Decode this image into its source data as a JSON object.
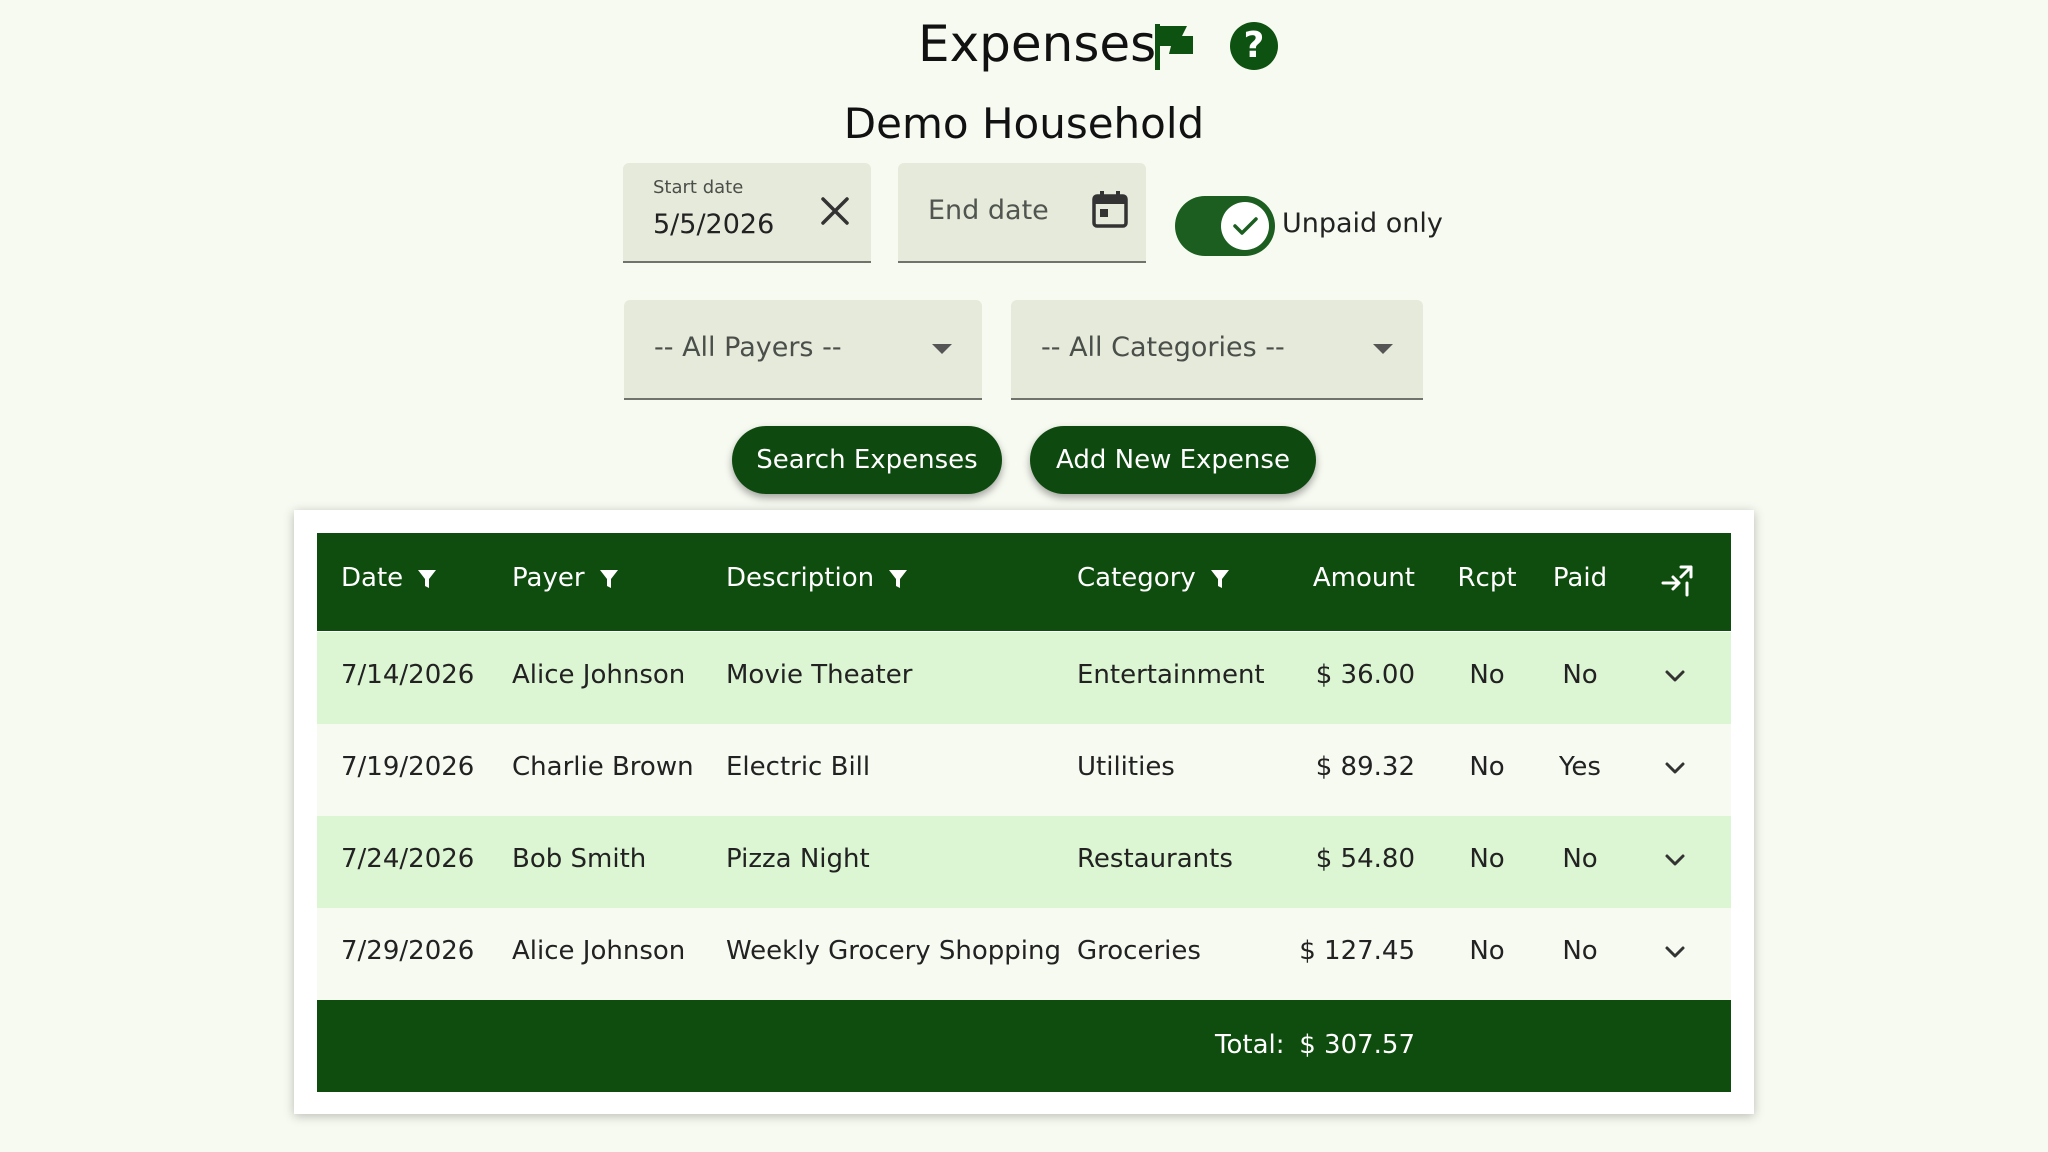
{
  "header": {
    "title": "Expenses",
    "household": "Demo Household",
    "accent": "#0e5212"
  },
  "filters": {
    "start_date_label": "Start date",
    "start_date_value": "5/5/2026",
    "end_date_placeholder": "End date",
    "unpaid_only_label": "Unpaid only",
    "unpaid_only_checked": true,
    "payers_selected": "-- All Payers --",
    "categories_selected": "-- All Categories --"
  },
  "actions": {
    "search_label": "Search Expenses",
    "add_label": "Add New Expense"
  },
  "table": {
    "columns": [
      "Date",
      "Payer",
      "Description",
      "Category",
      "Amount",
      "Rcpt",
      "Paid"
    ],
    "rows": [
      {
        "date": "7/14/2026",
        "payer": "Alice Johnson",
        "description": "Movie Theater",
        "category": "Entertainment",
        "amount": "$ 36.00",
        "rcpt": "No",
        "paid": "No"
      },
      {
        "date": "7/19/2026",
        "payer": "Charlie Brown",
        "description": "Electric Bill",
        "category": "Utilities",
        "amount": "$ 89.32",
        "rcpt": "No",
        "paid": "Yes"
      },
      {
        "date": "7/24/2026",
        "payer": "Bob Smith",
        "description": "Pizza Night",
        "category": "Restaurants",
        "amount": "$ 54.80",
        "rcpt": "No",
        "paid": "No"
      },
      {
        "date": "7/29/2026",
        "payer": "Alice Johnson",
        "description": "Weekly Grocery Shopping",
        "category": "Groceries",
        "amount": "$ 127.45",
        "rcpt": "No",
        "paid": "No"
      }
    ],
    "total_label": "Total:",
    "total_value": "$ 307.57"
  }
}
